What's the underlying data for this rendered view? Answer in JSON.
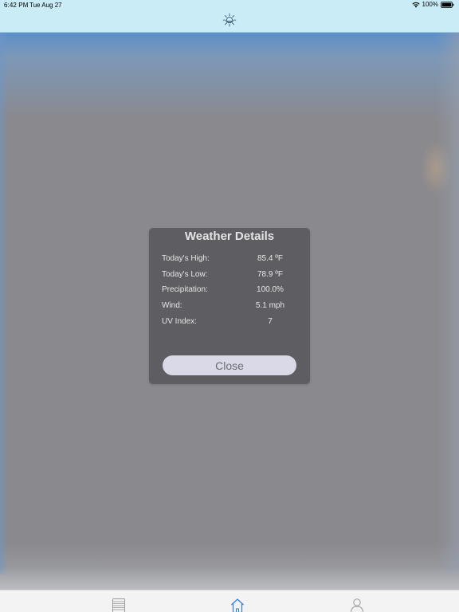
{
  "status_bar": {
    "time": "6:42 PM",
    "date": "Tue Aug 27",
    "battery": "100%"
  },
  "header": {
    "logo_icon": "sun-icon"
  },
  "dialog": {
    "title": "Weather Details",
    "details": [
      {
        "label": "Today's High:",
        "value": "85.4 ºF"
      },
      {
        "label": "Today's Low:",
        "value": "78.9 ºF"
      },
      {
        "label": "Precipitation:",
        "value": "100.0%"
      },
      {
        "label": "Wind:",
        "value": "5.1 mph"
      },
      {
        "label": "UV Index:",
        "value": "7"
      }
    ],
    "close_label": "Close"
  },
  "tab_bar": {
    "items": [
      {
        "icon": "document-icon"
      },
      {
        "icon": "home-icon",
        "selected": true
      },
      {
        "icon": "person-icon"
      }
    ]
  },
  "colors": {
    "header_bg": "#c9ecf7",
    "dialog_bg": "#5e5d61",
    "accent_blue": "#2f7fd6",
    "close_button_bg": "#d9d9e7"
  }
}
